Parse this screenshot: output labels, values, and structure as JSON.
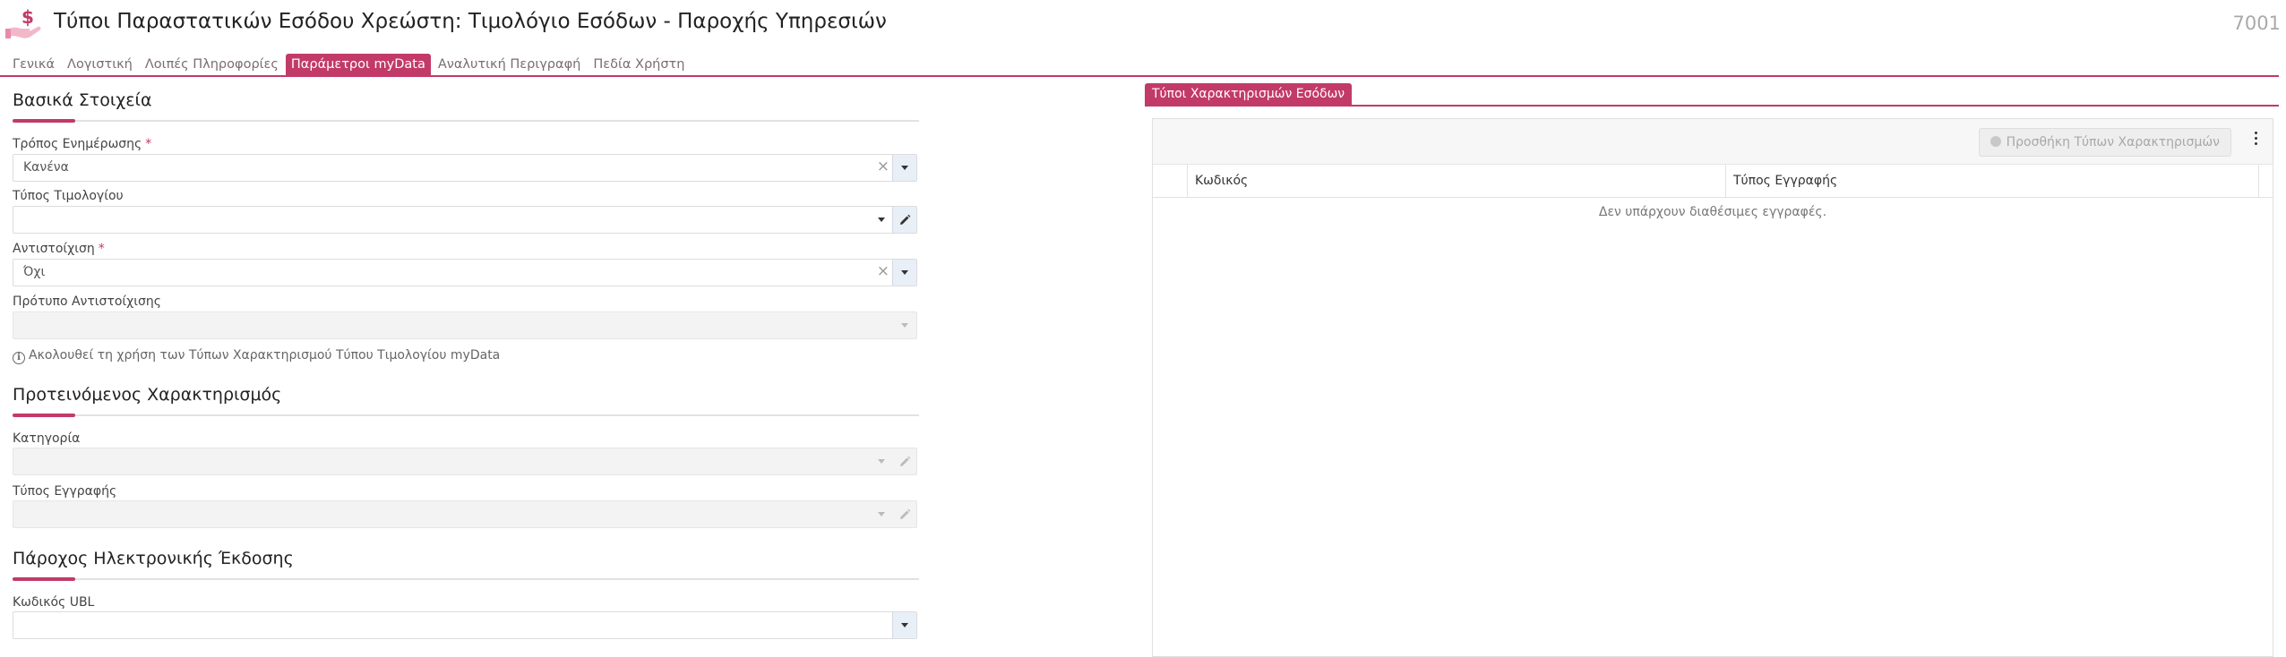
{
  "header": {
    "title": "Τύποι Παραστατικών Εσόδου Χρεώστη: Τιμολόγιο Εσόδων - Παροχής Υπηρεσιών",
    "record_id": "7001",
    "icon": "dollar-hand-icon"
  },
  "tabs": [
    {
      "label": "Γενικά"
    },
    {
      "label": "Λογιστική"
    },
    {
      "label": "Λοιπές Πληροφορίες"
    },
    {
      "label": "Παράμετροι myData",
      "active": true
    },
    {
      "label": "Αναλυτική Περιγραφή"
    },
    {
      "label": "Πεδία Χρήστη"
    }
  ],
  "basic": {
    "title": "Βασικά Στοιχεία",
    "update_mode": {
      "label": "Τρόπος Ενημέρωσης",
      "value": "Κανένα"
    },
    "invoice_type": {
      "label": "Τύπος Τιμολογίου",
      "value": ""
    },
    "mapping": {
      "label": "Αντιστοίχιση",
      "value": "Όχι"
    },
    "mapping_template": {
      "label": "Πρότυπο Αντιστοίχισης",
      "value": ""
    },
    "info": "Ακολουθεί τη χρήση των Τύπων Χαρακτηρισμού Τύπου Τιμολογίου myData"
  },
  "suggested": {
    "title": "Προτεινόμενος Χαρακτηρισμός",
    "category": {
      "label": "Κατηγορία",
      "value": ""
    },
    "entry_type": {
      "label": "Τύπος Εγγραφής",
      "value": ""
    }
  },
  "provider": {
    "title": "Πάροχος Ηλεκτρονικής Έκδοσης",
    "ubl": {
      "label": "Κωδικός UBL",
      "value": ""
    }
  },
  "right": {
    "tab_label": "Τύποι Χαρακτηρισμών Εσόδων",
    "add_button": "Προσθήκη Τύπων Χαρακτηρισμών",
    "columns": [
      "Κωδικός",
      "Τύπος Εγγραφής"
    ],
    "empty_text": "Δεν υπάρχουν διαθέσιμες εγγραφές."
  },
  "colors": {
    "accent": "#c23a68",
    "muted": "#a9a9a9"
  }
}
